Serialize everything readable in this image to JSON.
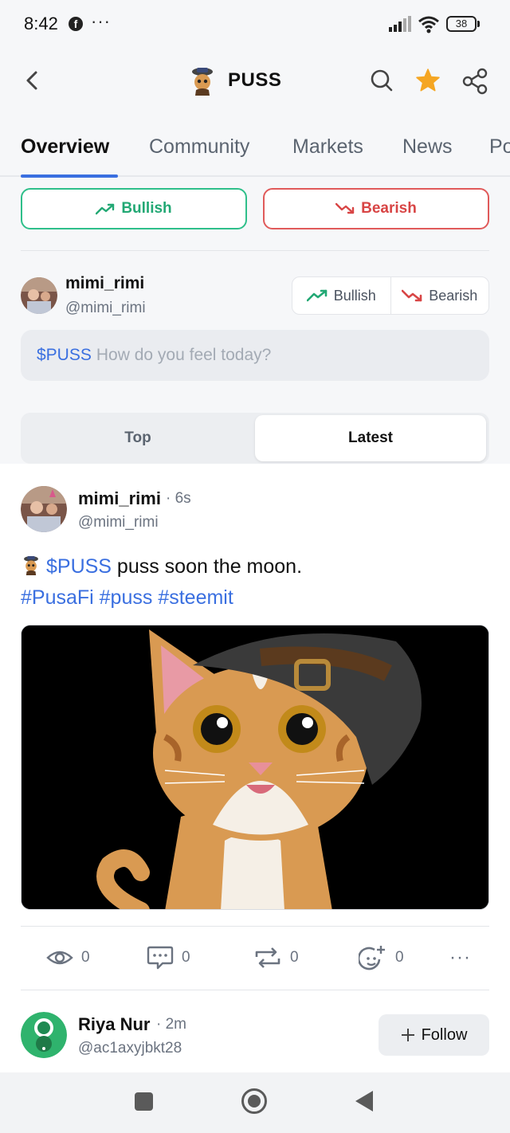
{
  "status_bar": {
    "time": "8:42",
    "battery": "38"
  },
  "header": {
    "title": "PUSS"
  },
  "tabs": [
    "Overview",
    "Community",
    "Markets",
    "News",
    "Po"
  ],
  "sentiment": {
    "bullish": "Bullish",
    "bearish": "Bearish"
  },
  "composer": {
    "name": "mimi_rimi",
    "handle": "@mimi_rimi",
    "toggle_bullish": "Bullish",
    "toggle_bearish": "Bearish",
    "ticker": "$PUSS",
    "placeholder": "How do you feel today?"
  },
  "segment": {
    "top": "Top",
    "latest": "Latest",
    "selected": "Latest"
  },
  "post": {
    "name": "mimi_rimi",
    "time": "· 6s",
    "handle": "@mimi_rimi",
    "ticker": "$PUSS",
    "text": " puss soon the moon.",
    "hashtags": "#PusaFi #puss #steemit",
    "stats": {
      "views": "0",
      "comments": "0",
      "reposts": "0",
      "reactions": "0"
    }
  },
  "next_post": {
    "name": "Riya Nur",
    "time": "· 2m",
    "handle": "@ac1axyjbkt28",
    "follow_label": "Follow"
  },
  "colors": {
    "accent": "#3a6fe0",
    "bullish": "#22a874",
    "bearish": "#d84545",
    "star": "#f5a623"
  },
  "icons": [
    "back-icon",
    "search-icon",
    "star-icon",
    "share-icon",
    "eye-icon",
    "comment-icon",
    "repost-icon",
    "reaction-icon",
    "more-icon",
    "plus-icon"
  ]
}
